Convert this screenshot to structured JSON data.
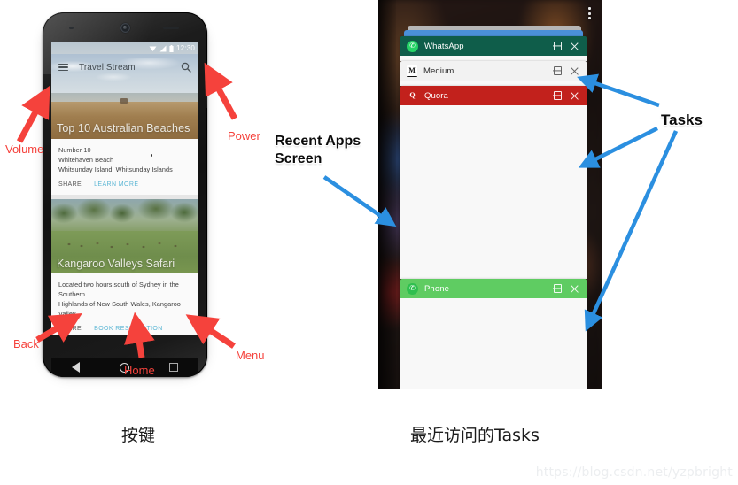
{
  "page": {
    "background": "#ffffff",
    "watermark": "https://blog.csdn.net/yzpbright"
  },
  "captions": {
    "left": "按键",
    "right": "最近访问的Tasks"
  },
  "phone": {
    "status_bar": {
      "time": "12:30",
      "icons": [
        "wifi-icon",
        "signal-icon",
        "battery-icon"
      ]
    },
    "app_bar": {
      "menu_icon": "hamburger-icon",
      "title": "Travel Stream",
      "search_icon": "search-icon"
    },
    "cards": [
      {
        "hero_caption": "Top 10 Australian Beaches",
        "lines": [
          "Number 10",
          "Whitehaven Beach",
          "Whitsunday Island, Whitsunday Islands"
        ],
        "share_label": "SHARE",
        "action_label": "LEARN MORE",
        "action_color": "#5bb6d4"
      },
      {
        "hero_caption": "Kangaroo Valleys Safari",
        "lines": [
          "Located two hours south of Sydney in the Southern",
          "Highlands of New South Wales, Kangaroo Valley..."
        ],
        "share_label": "SHARE",
        "action_label": "BOOK RESERVATION",
        "action_color": "#5bb6d4"
      }
    ],
    "nav_bar": {
      "back_icon": "back-triangle-icon",
      "home_icon": "home-circle-icon",
      "recents_icon": "recents-square-icon"
    }
  },
  "annotations": {
    "color_red": "#f5423c",
    "color_blue": "#2b8fe0",
    "red_labels": [
      {
        "key": "volume",
        "text": "Volume"
      },
      {
        "key": "power",
        "text": "Power"
      },
      {
        "key": "back",
        "text": "Back"
      },
      {
        "key": "home",
        "text": "Home"
      },
      {
        "key": "menu",
        "text": "Menu"
      }
    ],
    "black_labels": [
      {
        "key": "recent_apps",
        "text": "Recent Apps\nScreen"
      },
      {
        "key": "tasks",
        "text": "Tasks"
      }
    ]
  },
  "recents_screen": {
    "overflow_menu_icon": "more-vertical-icon",
    "wallpaper": "blurred-dark-photo",
    "ghost_cards": [
      {
        "name": "ghost-card-gray",
        "color": "#b6b6b6"
      },
      {
        "name": "ghost-card-blue",
        "color": "#4a90d9"
      }
    ],
    "tasks": [
      {
        "name": "WhatsApp",
        "header_color": "#0f5d4a",
        "text_color": "#ffffff",
        "icon_glyph": "✆",
        "icon_bg": "#25d366",
        "icon_fg": "#ffffff",
        "split_icon": "split-screen-icon",
        "close_icon": "close-icon"
      },
      {
        "name": "Medium",
        "header_color": "#f2f2f2",
        "text_color": "#2b2b2b",
        "icon_glyph": "M",
        "icon_bg": "#ffffff",
        "icon_fg": "#111111",
        "split_icon": "split-screen-icon",
        "close_icon": "close-icon"
      },
      {
        "name": "Quora",
        "header_color": "#c2211c",
        "text_color": "#ffffff",
        "icon_glyph": "Q",
        "icon_bg": "#c2211c",
        "icon_fg": "#ffffff",
        "split_icon": "split-screen-icon",
        "close_icon": "close-icon"
      },
      {
        "name": "Phone",
        "header_color": "#5fcc62",
        "text_color": "#ffffff",
        "icon_glyph": "✆",
        "icon_bg": "#2fbf4f",
        "icon_fg": "#ffffff",
        "split_icon": "split-screen-icon",
        "close_icon": "close-icon"
      }
    ]
  }
}
